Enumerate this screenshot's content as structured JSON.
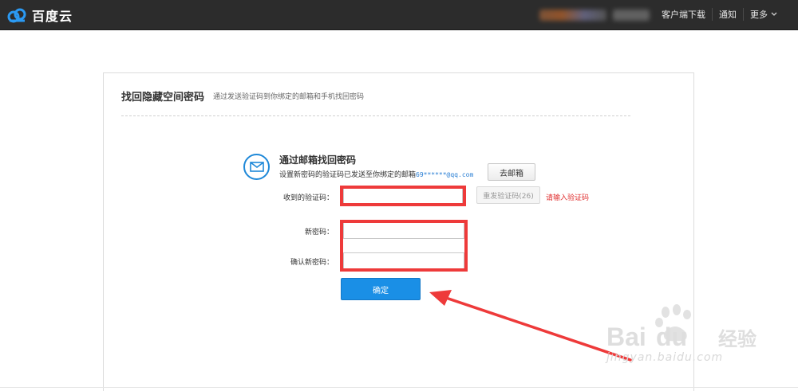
{
  "header": {
    "logo_text": "百度云",
    "nav": [
      "客户端下载",
      "通知",
      "更多"
    ]
  },
  "panel": {
    "title": "找回隐藏空间密码",
    "subtitle": "通过发送验证码到你绑定的邮箱和手机找回密码"
  },
  "email_section": {
    "heading": "通过邮箱找回密码",
    "sent_text": "设置新密码的验证码已发送至你绑定的邮箱",
    "email": "69******@qq.com",
    "goto_mailbox": "去邮箱"
  },
  "form": {
    "code_label": "收到的验证码：",
    "code_value": "",
    "resend": "重发验证码(26)",
    "error": "请输入验证码",
    "new_pwd_label": "新密码：",
    "new_pwd_value": "",
    "confirm_pwd_label": "确认新密码：",
    "confirm_pwd_value": "",
    "submit": "确定"
  },
  "watermark": {
    "brand": "Bai",
    "suffix": "经验",
    "url": "jingyan.baidu.com"
  },
  "colors": {
    "topbar": "#2c2c2c",
    "accent": "#1a8fe6",
    "highlight": "#ee3a3a",
    "error": "#e03030"
  }
}
